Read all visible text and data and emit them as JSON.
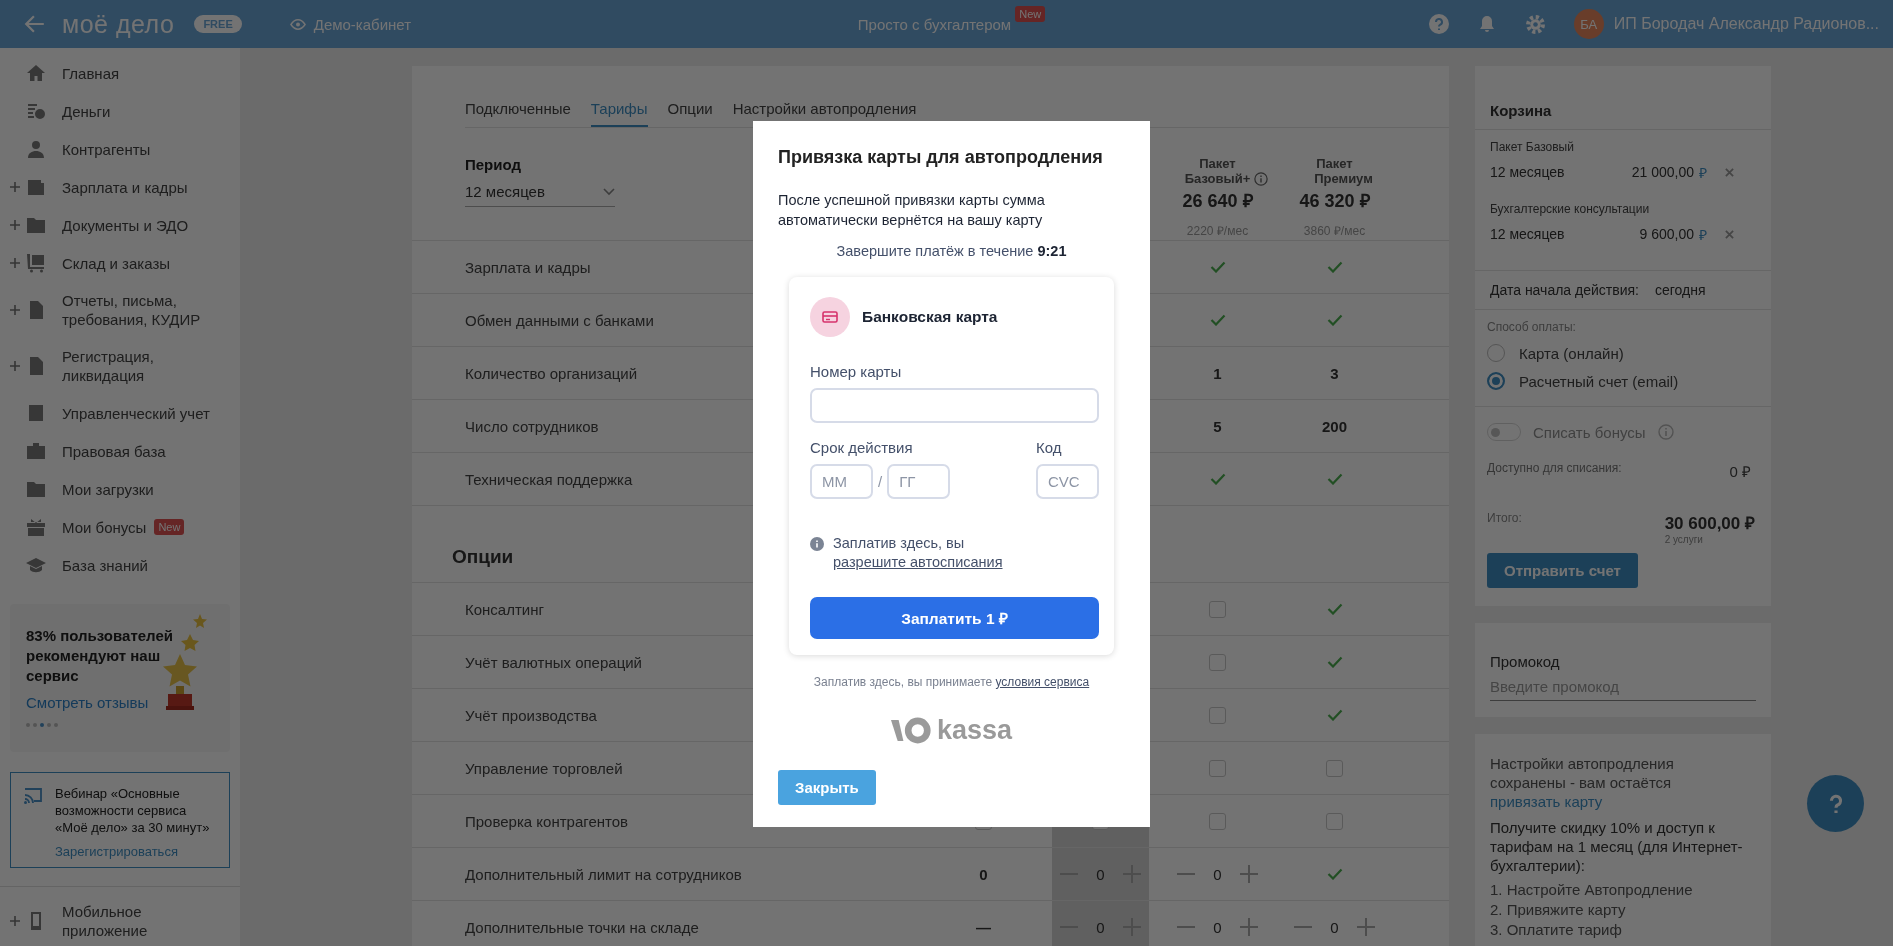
{
  "topbar": {
    "logo": "моё дело",
    "plan_badge": "FREE",
    "demo_link": "Демо-кабинет",
    "center_link": "Просто с бухгалтером",
    "center_badge": "New",
    "avatar_initials": "БА",
    "user_name": "ИП Бородач Александр Радионов..."
  },
  "sidebar": {
    "items": [
      {
        "label": "Главная",
        "expandable": false
      },
      {
        "label": "Деньги",
        "expandable": false
      },
      {
        "label": "Контрагенты",
        "expandable": false
      },
      {
        "label": "Зарплата и кадры",
        "expandable": true
      },
      {
        "label": "Документы и ЭДО",
        "expandable": true
      },
      {
        "label": "Склад и заказы",
        "expandable": true
      },
      {
        "label": "Отчеты, письма, требования, КУДИР",
        "expandable": true
      },
      {
        "label": "Регистрация, ликвидация",
        "expandable": true
      },
      {
        "label": "Управленческий учет",
        "expandable": false
      },
      {
        "label": "Правовая база",
        "expandable": false
      },
      {
        "label": "Мои загрузки",
        "expandable": false
      },
      {
        "label": "Мои бонусы",
        "expandable": false,
        "badge": "New"
      },
      {
        "label": "База знаний",
        "expandable": false
      }
    ],
    "promo": {
      "text": "83% пользователей рекомендуют наш сервис",
      "link": "Смотреть отзывы",
      "pager": [
        {
          "selected": false
        },
        {
          "selected": false
        },
        {
          "selected": true
        },
        {
          "selected": false
        },
        {
          "selected": false
        }
      ]
    },
    "webinar": {
      "text": "Вебинар «Основные возможности сервиса «Моё дело» за 30 минут»",
      "link": "Зарегистрироваться"
    },
    "bottom_items": [
      {
        "label": "Мобильное приложение",
        "expandable": true
      }
    ]
  },
  "tabs": [
    {
      "label": "Подключенные",
      "selected": false
    },
    {
      "label": "Тарифы",
      "selected": true
    },
    {
      "label": "Опции",
      "selected": false
    },
    {
      "label": "Настройки автопродления",
      "selected": false
    }
  ],
  "period": {
    "label": "Период",
    "value": "12 месяцев"
  },
  "plans": [
    {
      "selected": false
    },
    {
      "selected": true
    },
    {
      "selected": false,
      "title": "Пакет",
      "name": "Базовый+",
      "info": true,
      "price": "26 640 ₽",
      "monthly": "2220 ₽/мес"
    },
    {
      "selected": false,
      "title": "Пакет",
      "name": "Премиум",
      "info": false,
      "price": "46 320 ₽",
      "monthly": "3860 ₽/мес"
    }
  ],
  "features": [
    {
      "label": "Зарплата и кадры",
      "cells": [
        {
          "kind": "blank"
        },
        {
          "kind": "blank"
        },
        {
          "kind": "checkbox",
          "checked": true
        },
        {
          "kind": "checkbox",
          "checked": true
        }
      ]
    },
    {
      "label": "Обмен данными с банками",
      "cells": [
        {
          "kind": "blank"
        },
        {
          "kind": "blank"
        },
        {
          "kind": "checkbox",
          "checked": true
        },
        {
          "kind": "checkbox",
          "checked": true
        }
      ]
    },
    {
      "label": "Количество организаций",
      "cells": [
        {
          "kind": "blank"
        },
        {
          "kind": "blank"
        },
        {
          "kind": "text",
          "value": "1"
        },
        {
          "kind": "text",
          "value": "3"
        }
      ]
    },
    {
      "label": "Число сотрудников",
      "cells": [
        {
          "kind": "blank"
        },
        {
          "kind": "blank"
        },
        {
          "kind": "text",
          "value": "5"
        },
        {
          "kind": "text",
          "value": "200"
        }
      ]
    },
    {
      "label": "Техническая поддержка",
      "cells": [
        {
          "kind": "blank"
        },
        {
          "kind": "blank"
        },
        {
          "kind": "checkbox",
          "checked": true
        },
        {
          "kind": "checkbox",
          "checked": true
        }
      ]
    }
  ],
  "options_title": "Опции",
  "options": [
    {
      "label": "Консалтинг",
      "cells": [
        {
          "kind": "blank"
        },
        {
          "kind": "blank"
        },
        {
          "kind": "checkbox",
          "checked": false
        },
        {
          "kind": "checkbox",
          "checked": true
        }
      ]
    },
    {
      "label": "Учёт валютных операций",
      "cells": [
        {
          "kind": "blank"
        },
        {
          "kind": "blank"
        },
        {
          "kind": "checkbox",
          "checked": false
        },
        {
          "kind": "checkbox",
          "checked": true
        }
      ]
    },
    {
      "label": "Учёт производства",
      "cells": [
        {
          "kind": "blank"
        },
        {
          "kind": "blank"
        },
        {
          "kind": "checkbox",
          "checked": false
        },
        {
          "kind": "checkbox",
          "checked": true
        }
      ]
    },
    {
      "label": "Управление торговлей",
      "cells": [
        {
          "kind": "blank"
        },
        {
          "kind": "blank"
        },
        {
          "kind": "checkbox",
          "checked": false
        },
        {
          "kind": "checkbox",
          "checked": false
        }
      ]
    },
    {
      "label": "Проверка контрагентов",
      "cells": [
        {
          "kind": "checkbox",
          "checked": false
        },
        {
          "kind": "checkbox",
          "checked": false
        },
        {
          "kind": "checkbox",
          "checked": false
        },
        {
          "kind": "checkbox",
          "checked": false
        }
      ]
    },
    {
      "label": "Дополнительный лимит на сотрудников",
      "cells": [
        {
          "kind": "text",
          "value": "0"
        },
        {
          "kind": "stepper",
          "value": "0"
        },
        {
          "kind": "stepper",
          "value": "0"
        },
        {
          "kind": "checkbox",
          "checked": true
        }
      ]
    },
    {
      "label": "Дополнительные точки на складе",
      "cells": [
        {
          "kind": "text",
          "value": "—"
        },
        {
          "kind": "stepper",
          "value": "0"
        },
        {
          "kind": "stepper",
          "value": "0"
        },
        {
          "kind": "stepper",
          "value": "0"
        }
      ]
    }
  ],
  "cart": {
    "title": "Корзина",
    "items": [
      {
        "name": "Пакет Базовый",
        "period": "12 месяцев",
        "price": "21 000,00",
        "currency": "₽"
      },
      {
        "name": "Бухгалтерские консультации",
        "period": "12 месяцев",
        "price": "9 600,00",
        "currency": "₽"
      }
    ],
    "start_label": "Дата начала действия:",
    "start_value": "сегодня",
    "payment_label": "Способ оплаты:",
    "payment_methods": [
      {
        "label": "Карта (онлайн)",
        "selected": false
      },
      {
        "label": "Расчетный счет (email)",
        "selected": true
      }
    ],
    "bonus_toggle": {
      "label": "Списать бонусы",
      "on": false,
      "disabled": true
    },
    "available_label": "Доступно для списания:",
    "available_value": "0 ₽",
    "total_label": "Итого:",
    "total": "30 600,00 ₽",
    "total_note": "2 услуги",
    "send_button": "Отправить счет"
  },
  "promo_code": {
    "label": "Промокод",
    "placeholder": "Введите промокод"
  },
  "autorenew": {
    "text": "Настройки автопродления сохранены - вам остаётся",
    "link": "привязать карту",
    "offer": "Получите скидку 10% и доступ к тарифам на 1 месяц (для Интернет-бухгалтерии):",
    "steps": [
      "1. Настройте Автопродление",
      "2. Привяжите карту",
      "3. Оплатите тариф"
    ]
  },
  "modal": {
    "title": "Привязка карты для автопродления",
    "text": "После успешной привязки карты сумма автоматически вернётся на вашу карту",
    "timer": "Завершите платёж в течение **9:21**",
    "method": "Банковская карта",
    "number_label": "Номер карты",
    "expiry_label": "Срок действия",
    "month_placeholder": "ММ",
    "separator": "/",
    "year_placeholder": "ГГ",
    "cvc_label": "Код",
    "cvc_placeholder": "CVC",
    "notice": "Заплатив здесь, вы",
    "notice_link": "разрешите автосписания",
    "pay_button": "Заплатить 1 ₽",
    "terms": "Заплатив здесь, вы принимаете",
    "terms_link": "условия сервиса",
    "brand": "kassa",
    "close_button": "Закрыть"
  }
}
